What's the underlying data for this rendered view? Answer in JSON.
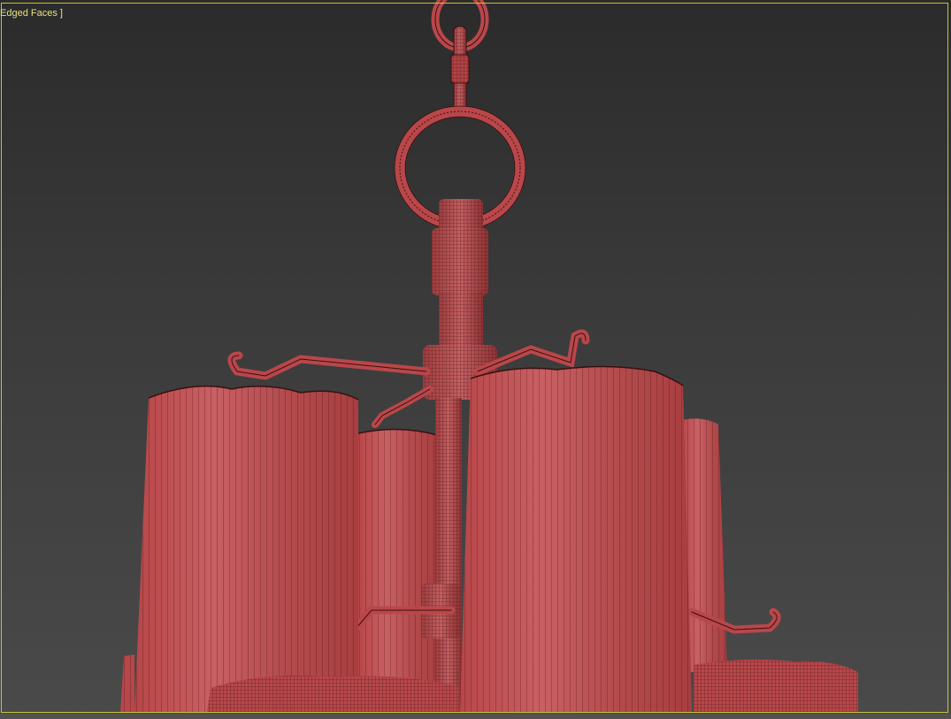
{
  "viewport": {
    "shading_label": "Edged Faces ]",
    "border_color": "#c8c23a",
    "label_color": "#e7e27c"
  },
  "model": {
    "base_color": "#b9474a",
    "wire_color": "#3a0f10"
  }
}
